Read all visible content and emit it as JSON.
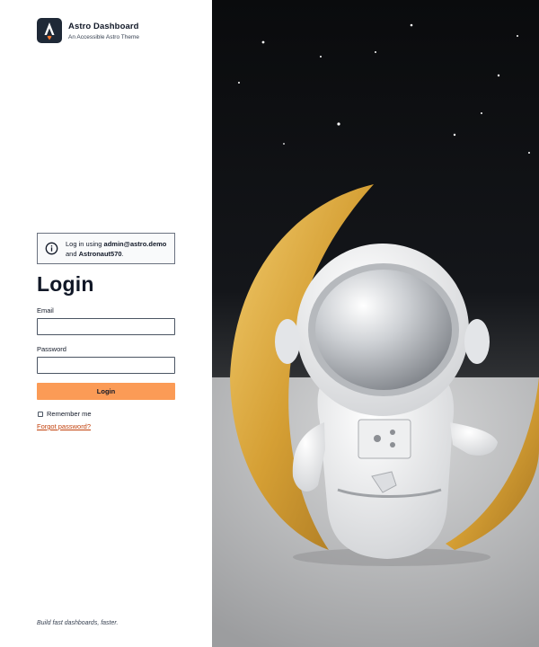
{
  "brand": {
    "title": "Astro Dashboard",
    "subtitle": "An Accessible Astro Theme",
    "logo_icon": "astro-logo-icon"
  },
  "alert": {
    "icon": "info-icon",
    "prefix": "Log in using ",
    "email": "admin@astro.demo",
    "middle": " and ",
    "password": "Astronaut570",
    "suffix": "."
  },
  "login": {
    "heading": "Login",
    "email_label": "Email",
    "email_value": "",
    "password_label": "Password",
    "password_value": "",
    "submit_label": "Login",
    "remember_label": "Remember me",
    "forgot_label": "Forgot password?"
  },
  "footer": {
    "tagline": "Build fast dashboards, faster."
  },
  "colors": {
    "accent": "#fb9b56",
    "link": "#c2410c",
    "logo_bg": "#1f2937"
  },
  "hero_image": "astronaut-on-crescent-moon-photo"
}
